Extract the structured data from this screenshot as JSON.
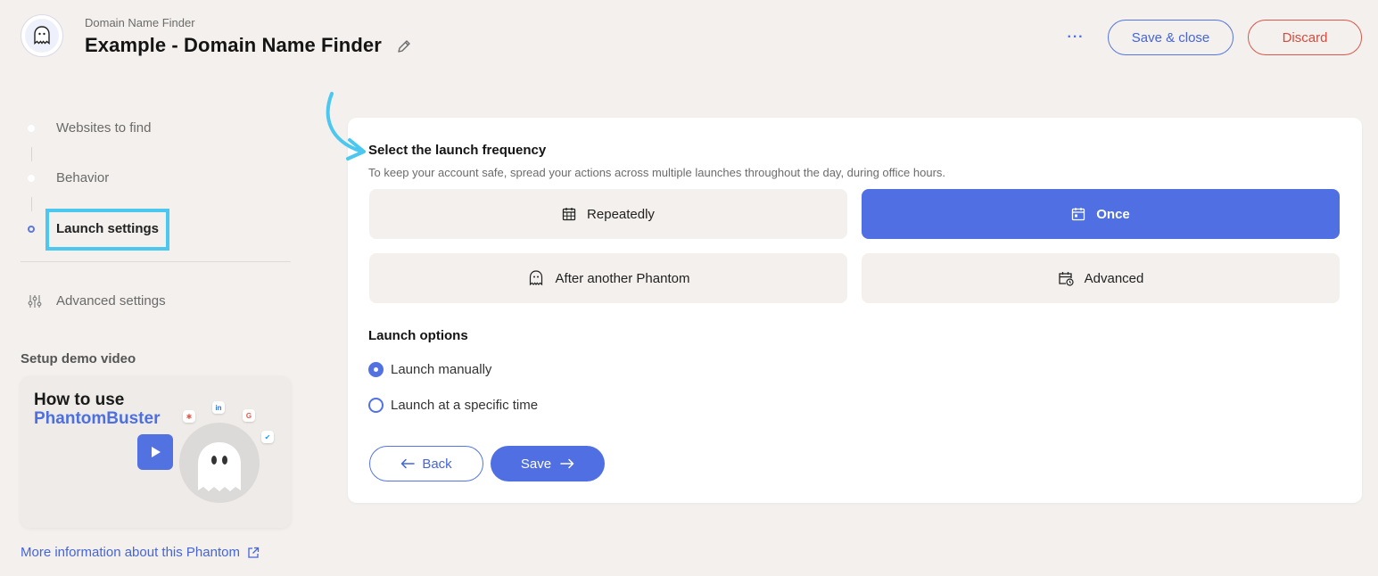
{
  "header": {
    "subtitle": "Domain Name Finder",
    "title": "Example - Domain Name Finder",
    "more_label": "···",
    "save_close_label": "Save & close",
    "discard_label": "Discard"
  },
  "sidebar": {
    "steps": [
      {
        "label": "Websites to find",
        "active": false
      },
      {
        "label": "Behavior",
        "active": false
      },
      {
        "label": "Launch settings",
        "active": true
      }
    ],
    "advanced_label": "Advanced settings",
    "demo_title": "Setup demo video",
    "video": {
      "line1": "How to use",
      "line2": "PhantomBuster"
    },
    "more_info_label": "More information about this Phantom"
  },
  "main": {
    "frequency": {
      "title": "Select the launch frequency",
      "description": "To keep your account safe, spread your actions across multiple launches throughout the day, during office hours.",
      "options": [
        {
          "label": "Repeatedly",
          "icon": "calendar-grid-icon",
          "selected": false
        },
        {
          "label": "Once",
          "icon": "calendar-icon",
          "selected": true
        },
        {
          "label": "After another Phantom",
          "icon": "ghost-icon",
          "selected": false
        },
        {
          "label": "Advanced",
          "icon": "calendar-clock-icon",
          "selected": false
        }
      ]
    },
    "launch_options": {
      "title": "Launch options",
      "radios": [
        {
          "label": "Launch manually",
          "checked": true
        },
        {
          "label": "Launch at a specific time",
          "checked": false
        }
      ]
    },
    "back_label": "Back",
    "save_label": "Save"
  },
  "colors": {
    "accent": "#4f6fe3",
    "danger": "#d64a3c",
    "highlight": "#4cc7ef",
    "background": "#f3f0ed"
  }
}
